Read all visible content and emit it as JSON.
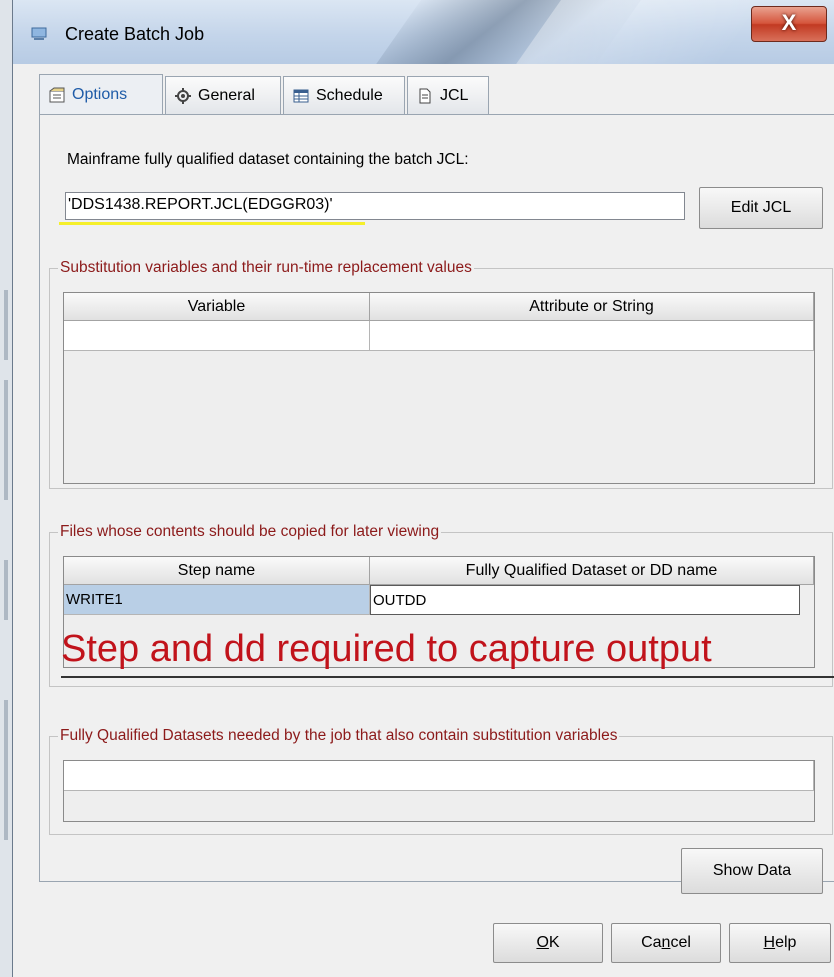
{
  "window": {
    "title": "Create Batch Job",
    "close_label": "X"
  },
  "tabs": [
    {
      "label": "Options",
      "icon": "options-icon",
      "active": true
    },
    {
      "label": "General",
      "icon": "gear-icon",
      "active": false
    },
    {
      "label": "Schedule",
      "icon": "table-icon",
      "active": false
    },
    {
      "label": "JCL",
      "icon": "document-icon",
      "active": false
    }
  ],
  "options": {
    "jcl_label": "Mainframe fully qualified dataset containing the batch JCL:",
    "dataset_value": "'DDS1438.REPORT.JCL(EDGGR03)'",
    "edit_jcl_button": "Edit JCL",
    "substitution": {
      "legend": "Substitution variables and their run-time replacement values",
      "columns": [
        "Variable",
        "Attribute or String"
      ],
      "rows": [
        [
          "",
          ""
        ]
      ]
    },
    "files": {
      "legend": "Files whose contents should be copied for later viewing",
      "columns": [
        "Step name",
        "Fully Qualified Dataset or DD name"
      ],
      "rows": [
        [
          "WRITE1",
          "OUTDD"
        ]
      ]
    },
    "datasets": {
      "legend": "Fully Qualified Datasets needed by the job that also contain substitution variables",
      "rows": [
        [
          ""
        ]
      ]
    },
    "show_data_button": "Show Data"
  },
  "annotation": {
    "caption": "Step and dd required to capture output",
    "color": "#c1131b"
  },
  "footer": {
    "ok_prefix": "",
    "ok_mnemonic": "O",
    "ok_suffix": "K",
    "cancel_prefix": "Ca",
    "cancel_mnemonic": "n",
    "cancel_suffix": "cel",
    "help_prefix": "",
    "help_mnemonic": "H",
    "help_suffix": "elp"
  }
}
